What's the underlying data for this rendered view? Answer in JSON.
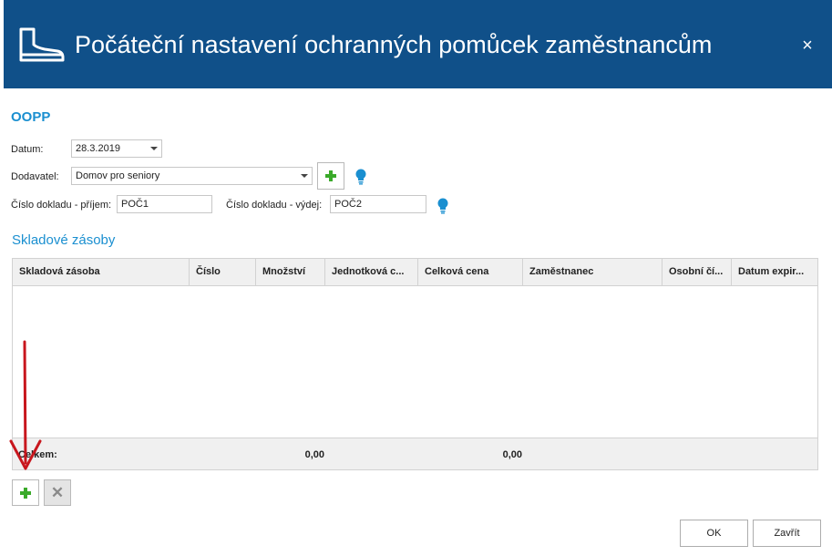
{
  "header": {
    "title": "Počáteční nastavení ochranných pomůcek zaměstnancům",
    "icon": "boot-icon",
    "close_label": "×",
    "background": "#105089"
  },
  "form": {
    "section_title": "OOPP",
    "datum_label": "Datum:",
    "datum_value": "28.3.2019",
    "dodavatel_label": "Dodavatel:",
    "dodavatel_value": "Domov pro seniory",
    "prijem_label": "Číslo dokladu - příjem:",
    "prijem_value": "POČ1",
    "vydej_label": "Číslo dokladu - výdej:",
    "vydej_value": "POČ2"
  },
  "grid": {
    "title": "Skladové zásoby",
    "columns": [
      "Skladová zásoba",
      "Číslo",
      "Množství",
      "Jednotková c...",
      "Celková cena",
      "Zaměstnanec",
      "Osobní čí...",
      "Datum expir..."
    ],
    "rows": [],
    "footer": {
      "label": "Celkem:",
      "mnozstvi_total": "0,00",
      "celkova_cena_total": "0,00"
    }
  },
  "buttons": {
    "ok": "OK",
    "close": "Zavřít",
    "delete_symbol": "✕"
  },
  "colors": {
    "accent": "#1a8fd0",
    "add_green": "#3aaa2a",
    "annotation_arrow": "#c8161d"
  }
}
